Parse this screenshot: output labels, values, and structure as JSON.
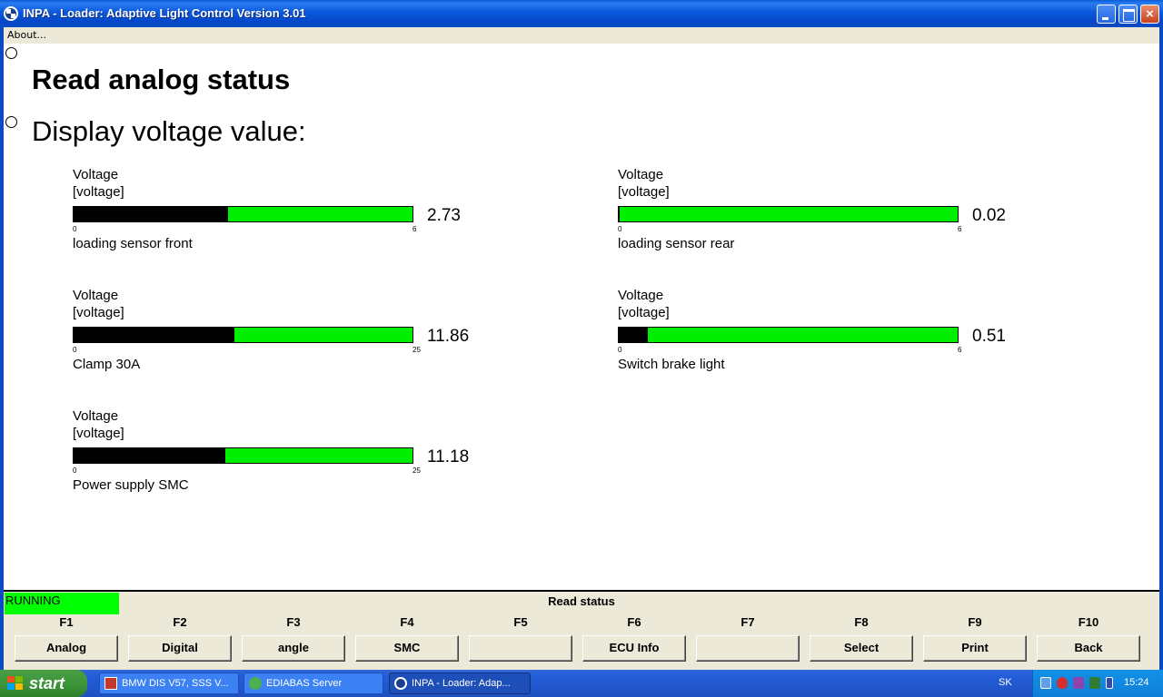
{
  "window": {
    "title": "INPA - Loader:  Adaptive Light Control Version 3.01",
    "icon": "bmw-logo-icon",
    "controls": [
      "minimize",
      "maximize",
      "close"
    ],
    "close_glyph": "×"
  },
  "menu": {
    "about": "About..."
  },
  "main": {
    "heading": "Read analog status",
    "subheading": "Display voltage value:"
  },
  "gauges": [
    {
      "label": "Voltage",
      "unit": "[voltage]",
      "min": "0",
      "max": "6",
      "value": "2.73",
      "fill_fraction": 0.455,
      "caption": "loading sensor front"
    },
    {
      "label": "Voltage",
      "unit": "[voltage]",
      "min": "0",
      "max": "6",
      "value": "0.02",
      "fill_fraction": 0.003,
      "caption": "loading sensor rear"
    },
    {
      "label": "Voltage",
      "unit": "[voltage]",
      "min": "0",
      "max": "25",
      "value": "11.86",
      "fill_fraction": 0.4744,
      "caption": "Clamp 30A"
    },
    {
      "label": "Voltage",
      "unit": "[voltage]",
      "min": "0",
      "max": "6",
      "value": "0.51",
      "fill_fraction": 0.085,
      "caption": "Switch brake light"
    },
    {
      "label": "Voltage",
      "unit": "[voltage]",
      "min": "0",
      "max": "25",
      "value": "11.18",
      "fill_fraction": 0.4472,
      "caption": "Power supply SMC"
    }
  ],
  "status": {
    "state": "RUNNING",
    "title": "Read status"
  },
  "function_keys": [
    {
      "key": "F1",
      "label": "Analog"
    },
    {
      "key": "F2",
      "label": "Digital"
    },
    {
      "key": "F3",
      "label": "angle"
    },
    {
      "key": "F4",
      "label": "SMC"
    },
    {
      "key": "F5",
      "label": ""
    },
    {
      "key": "F6",
      "label": "ECU Info"
    },
    {
      "key": "F7",
      "label": ""
    },
    {
      "key": "F8",
      "label": "Select"
    },
    {
      "key": "F9",
      "label": "Print"
    },
    {
      "key": "F10",
      "label": "Back"
    }
  ],
  "taskbar": {
    "start": "start",
    "tasks": [
      {
        "label": "BMW DIS V57, SSS V...",
        "icon": "pdf-icon"
      },
      {
        "label": "EDIABAS Server",
        "icon": "ediabas-icon"
      },
      {
        "label": "INPA - Loader:  Adap...",
        "icon": "bmw-logo-icon"
      }
    ],
    "language": "SK",
    "clock": "15:24",
    "tray_icons": [
      "network-icon",
      "shield-icon",
      "flag-icon",
      "speaker-icon",
      "battery-icon"
    ]
  },
  "colors": {
    "bar": "#00ee00",
    "bar_fill": "#000000",
    "running": "#00ff00"
  }
}
